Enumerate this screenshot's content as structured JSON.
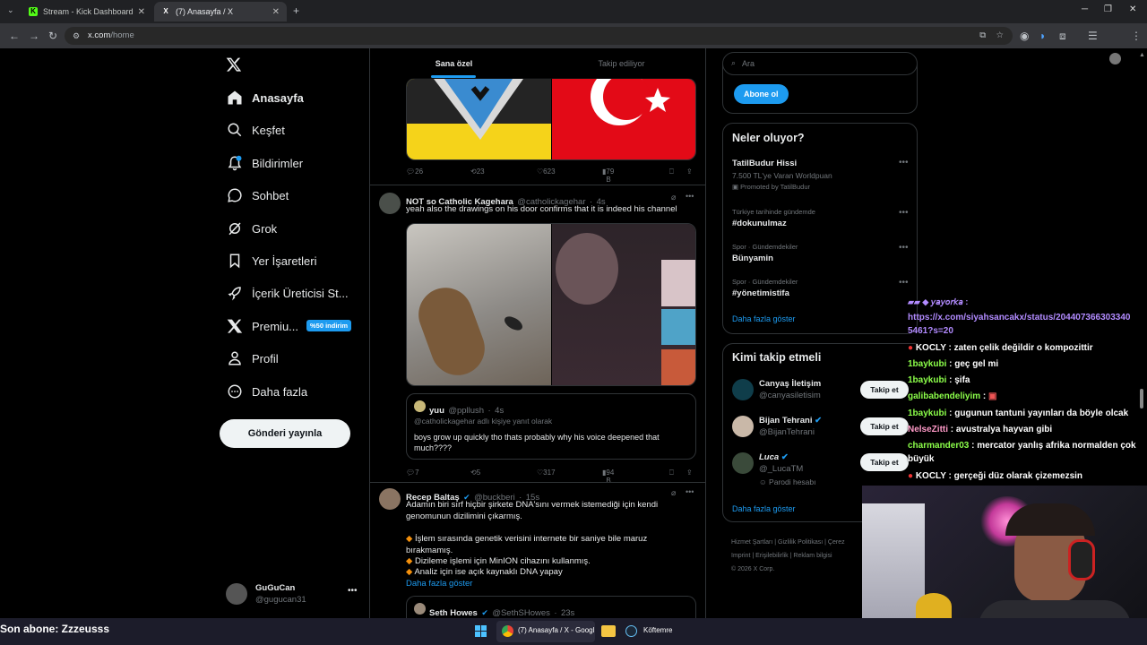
{
  "browser": {
    "tabs": [
      {
        "title": "Stream - Kick Dashboard",
        "favicon": "K"
      },
      {
        "title": "(7) Anasayfa / X",
        "favicon": "X"
      }
    ],
    "url_host": "x.com",
    "url_path": "/home"
  },
  "nav": {
    "items": [
      {
        "label": "Anasayfa",
        "icon": "home-icon"
      },
      {
        "label": "Keşfet",
        "icon": "search-icon"
      },
      {
        "label": "Bildirimler",
        "icon": "bell-icon"
      },
      {
        "label": "Sohbet",
        "icon": "chat-icon"
      },
      {
        "label": "Grok",
        "icon": "grok-icon"
      },
      {
        "label": "Yer İşaretleri",
        "icon": "bookmark-icon"
      },
      {
        "label": "İçerik Üreticisi St...",
        "icon": "rocket-icon"
      },
      {
        "label": "Premiu...",
        "icon": "x-icon"
      },
      {
        "label": "Profil",
        "icon": "person-icon"
      },
      {
        "label": "Daha fazla",
        "icon": "more-circle-icon"
      }
    ],
    "premium_badge": "%50 indirim",
    "post_button": "Gönderi yayınla",
    "account": {
      "name": "GuGuCan",
      "handle": "@gugucan31"
    }
  },
  "timeline": {
    "tabs": [
      "Sana özel",
      "Takip ediliyor"
    ],
    "tweet1_actions": {
      "replies": "26",
      "reposts": "23",
      "likes": "623",
      "views": "79 B"
    },
    "tweet2": {
      "name": "NOT so Catholic Kagehara",
      "handle": "@catholickagehar",
      "time": "4s",
      "text": "yeah also the drawings on his door confirms that it is indeed his channel",
      "quote": {
        "name": "yuu",
        "handle": "@ppllush",
        "time": "4s",
        "reply_to": "@catholickagehar adlı kişiye yanıt olarak",
        "text": "boys grow up quickly tho thats probably why his voice deepened that much????"
      },
      "actions": {
        "replies": "7",
        "reposts": "5",
        "likes": "317",
        "views": "94 B"
      }
    },
    "tweet3": {
      "name": "Recep Baltaş",
      "handle": "@buckberi",
      "time": "15s",
      "text": "Adamın biri sırf hiçbir şirkete DNA'sını vermek istemediği için kendi genomunun dizilimini çıkarmış.",
      "bullets": [
        "İşlem sırasında genetik verisini internete bir saniye bile maruz bırakmamış.",
        "Dizileme işlemi için MinION cihazını kullanmış.",
        "Analiz için ise açık kaynaklı DNA yapay"
      ],
      "show_more": "Daha fazla göster",
      "quote_name": "Seth Howes",
      "quote_handle": "@SethSHowes",
      "quote_time": "23s"
    }
  },
  "sidebar": {
    "search_placeholder": "Ara",
    "subscribe_button": "Abone ol",
    "trends_title": "Neler oluyor?",
    "trends": [
      {
        "name": "TatilBudur Hissi",
        "sub": "7.500 TL'ye Varan Worldpuan",
        "promo": "Promoted by TatilBudur"
      },
      {
        "cat": "Türkiye tarihinde gündemde",
        "name": "#dokunulmaz"
      },
      {
        "cat": "Spor · Gündemdekiler",
        "name": "Bünyamin"
      },
      {
        "cat": "Spor · Gündemdekiler",
        "name": "#yönetimistifa"
      }
    ],
    "show_more": "Daha fazla göster",
    "who_title": "Kimi takip etmeli",
    "who": [
      {
        "name": "Canyaş İletişim",
        "handle": "@canyasiletisim"
      },
      {
        "name": "Bijan Tehrani",
        "handle": "@BijanTehrani"
      },
      {
        "name": "Luca",
        "handle": "@_LucaTM",
        "note": "Parodi hesabı"
      }
    ],
    "follow_label": "Takip et",
    "who_show_more": "Daha fazla göster",
    "footer": [
      "Hizmet Şartları",
      "Gizlilik Politikası",
      "Çerez",
      "Imprint",
      "Erişilebilirlik",
      "Reklam bilgisi",
      "© 2026 X Corp."
    ]
  },
  "chat": {
    "lines": [
      {
        "user": "",
        "msg": "https://x.com/siyahsancakx/status/204407366303340",
        "color": "#b28bff"
      },
      {
        "user": "",
        "msg": "5461?s=20",
        "color": "#b28bff"
      },
      {
        "user": "KOCLY",
        "msg": ": zaten çelik değildir o kompozittir",
        "color": "#ffffff"
      },
      {
        "user": "1baykubi",
        "msg": ": geç gel mi",
        "color": "#8cff4a"
      },
      {
        "user": "1baykubi",
        "msg": ": şifa",
        "color": "#8cff4a"
      },
      {
        "user": "galibabendeliyim",
        "msg": ":",
        "color": "#8cff4a"
      },
      {
        "user": "1baykubi",
        "msg": ": gugunun tantuni yayınları da böyle olcak",
        "color": "#8cff4a"
      },
      {
        "user": "NelseZitti",
        "msg": ": avustralya hayvan gibi",
        "color": "#ff9ac8"
      },
      {
        "user": "charmander03",
        "msg": ": mercator yanlış afrika normalden çok",
        "color": "#8cff4a"
      },
      {
        "user": "",
        "msg": "büyük",
        "color": "#ffffff"
      },
      {
        "user": "KOCLY",
        "msg": ": gerçeği düz olarak çizemezsin",
        "color": "#ffffff"
      }
    ],
    "last_sub": "Son abone: Zzzeusss"
  },
  "taskbar": {
    "chrome_label": "(7) Anasayfa / X - Googl",
    "steam_label": "Köftemre"
  },
  "colors": {
    "accent": "#1d9bf0",
    "bg": "#000000",
    "border": "#2f3336"
  }
}
